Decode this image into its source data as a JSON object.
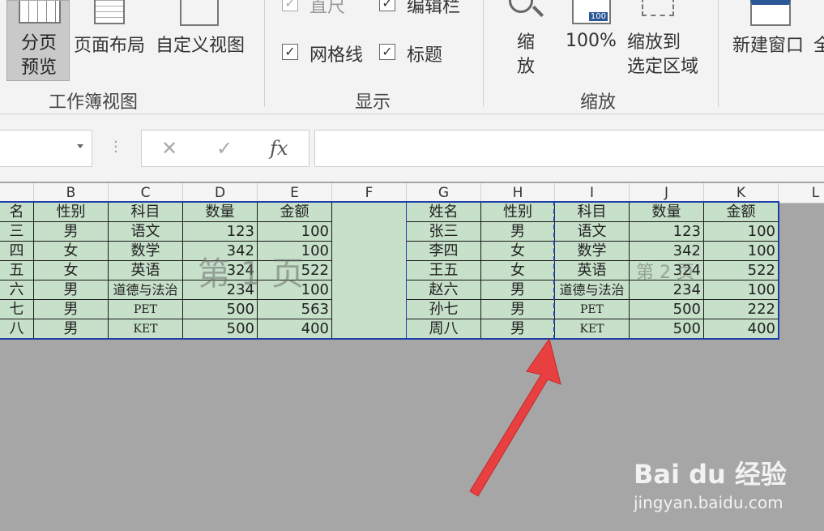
{
  "ribbon": {
    "buttons": {
      "page_break_preview": "分页\n预览",
      "page_layout": "页面布局",
      "custom_view": "自定义视图",
      "zoom": "缩\n放",
      "zoom_100": "100%",
      "zoom_selection": "缩放到\n选定区域",
      "new_window": "新建窗口",
      "arrange_partial": "全"
    },
    "checkboxes": {
      "ruler": "直尺",
      "formula_bar": "编辑栏",
      "gridlines": "网格线",
      "headings": "标题"
    },
    "groups": {
      "workbook_views": "工作簿视图",
      "show": "显示",
      "zoom": "缩放"
    },
    "zoom_icon_text": "100"
  },
  "formula_bar": {
    "cancel": "✕",
    "enter": "✓",
    "fx": "fx",
    "value": ""
  },
  "columns": [
    "B",
    "C",
    "D",
    "E",
    "F",
    "G",
    "H",
    "I",
    "J",
    "K",
    "L"
  ],
  "headers": [
    "名",
    "性别",
    "科目",
    "数量",
    "金额",
    "",
    "姓名",
    "性别",
    "科目",
    "数量",
    "金额"
  ],
  "rows": [
    [
      "三",
      "男",
      "语文",
      "123",
      "100",
      "",
      "张三",
      "男",
      "语文",
      "123",
      "100"
    ],
    [
      "四",
      "女",
      "数学",
      "342",
      "100",
      "",
      "李四",
      "女",
      "数学",
      "342",
      "100"
    ],
    [
      "五",
      "女",
      "英语",
      "324",
      "522",
      "",
      "王五",
      "女",
      "英语",
      "324",
      "522"
    ],
    [
      "六",
      "男",
      "道德与法治",
      "234",
      "100",
      "",
      "赵六",
      "男",
      "道德与法治",
      "234",
      "100"
    ],
    [
      "七",
      "男",
      "PET",
      "500",
      "563",
      "",
      "孙七",
      "男",
      "PET",
      "500",
      "222"
    ],
    [
      "八",
      "男",
      "KET",
      "500",
      "400",
      "",
      "周八",
      "男",
      "KET",
      "500",
      "400"
    ]
  ],
  "page_labels": {
    "page1": "第 1 页",
    "page2": "第 2 页"
  },
  "watermark": {
    "brand": "Bai du 经验",
    "url": "jingyan.baidu.com"
  },
  "colors": {
    "page_border": "#1f3fa8",
    "cell_fill": "#c6e0c9",
    "arrow": "#e84040"
  }
}
